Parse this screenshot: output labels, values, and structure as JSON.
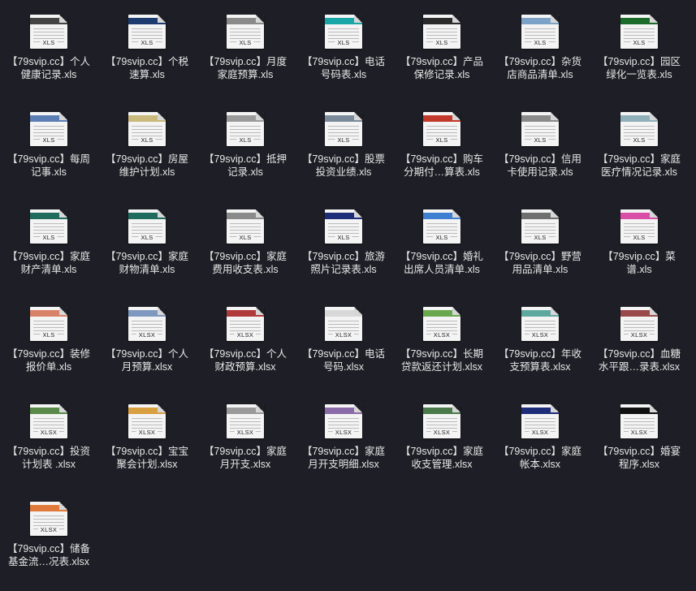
{
  "files": [
    {
      "name": "【79svip.cc】个人\n健康记录.xls",
      "ext": "XLS",
      "accent": "#444444",
      "icon": "spreadsheet-file-icon"
    },
    {
      "name": "【79svip.cc】个税\n速算.xls",
      "ext": "XLS",
      "accent": "#1d3b6e",
      "icon": "spreadsheet-file-icon"
    },
    {
      "name": "【79svip.cc】月度\n家庭预算.xls",
      "ext": "XLS",
      "accent": "#8a8a8a",
      "icon": "spreadsheet-file-icon"
    },
    {
      "name": "【79svip.cc】电话\n号码表.xls",
      "ext": "XLS",
      "accent": "#19a6a6",
      "icon": "spreadsheet-file-icon"
    },
    {
      "name": "【79svip.cc】产品\n保修记录.xls",
      "ext": "XLS",
      "accent": "#2b2b2b",
      "icon": "spreadsheet-file-icon"
    },
    {
      "name": "【79svip.cc】杂货\n店商品清单.xls",
      "ext": "XLS",
      "accent": "#7da2c7",
      "icon": "spreadsheet-file-icon"
    },
    {
      "name": "【79svip.cc】园区\n绿化一览表.xls",
      "ext": "XLS",
      "accent": "#1b6b2a",
      "icon": "spreadsheet-file-icon"
    },
    {
      "name": "【79svip.cc】每周\n记事.xls",
      "ext": "XLS",
      "accent": "#5b7fb5",
      "icon": "spreadsheet-file-icon"
    },
    {
      "name": "【79svip.cc】房屋\n维护计划.xls",
      "ext": "XLS",
      "accent": "#c9b97a",
      "icon": "spreadsheet-file-icon"
    },
    {
      "name": "【79svip.cc】抵押\n记录.xls",
      "ext": "XLS",
      "accent": "#9a9a9a",
      "icon": "spreadsheet-file-icon"
    },
    {
      "name": "【79svip.cc】股票\n投资业绩.xls",
      "ext": "XLS",
      "accent": "#7a8a9a",
      "icon": "spreadsheet-file-icon"
    },
    {
      "name": "【79svip.cc】购车\n分期付…算表.xls",
      "ext": "XLS",
      "accent": "#c0392b",
      "icon": "spreadsheet-file-icon"
    },
    {
      "name": "【79svip.cc】信用\n卡使用记录.xls",
      "ext": "XLS",
      "accent": "#8a8a8a",
      "icon": "spreadsheet-file-icon"
    },
    {
      "name": "【79svip.cc】家庭\n医疗情况记录.xls",
      "ext": "XLS",
      "accent": "#8fb0b8",
      "icon": "spreadsheet-file-icon"
    },
    {
      "name": "【79svip.cc】家庭\n财产清单.xls",
      "ext": "XLS",
      "accent": "#1f6b5e",
      "icon": "spreadsheet-file-icon"
    },
    {
      "name": "【79svip.cc】家庭\n财物清单.xls",
      "ext": "XLS",
      "accent": "#1f6b5e",
      "icon": "spreadsheet-file-icon"
    },
    {
      "name": "【79svip.cc】家庭\n费用收支表.xls",
      "ext": "XLS",
      "accent": "#8a8a8a",
      "icon": "spreadsheet-file-icon"
    },
    {
      "name": "【79svip.cc】旅游\n照片记录表.xls",
      "ext": "XLS",
      "accent": "#1e2d7a",
      "icon": "spreadsheet-file-icon"
    },
    {
      "name": "【79svip.cc】婚礼\n出席人员清单.xls",
      "ext": "XLS",
      "accent": "#3f7fd1",
      "icon": "spreadsheet-file-icon"
    },
    {
      "name": "【79svip.cc】野营\n用品清单.xls",
      "ext": "XLS",
      "accent": "#6f6f6f",
      "icon": "spreadsheet-file-icon"
    },
    {
      "name": "【79svip.cc】菜\n谱.xls",
      "ext": "XLS",
      "accent": "#d94fa8",
      "icon": "spreadsheet-file-icon"
    },
    {
      "name": "【79svip.cc】装修\n报价单.xls",
      "ext": "XLS",
      "accent": "#d9826a",
      "icon": "spreadsheet-file-icon"
    },
    {
      "name": "【79svip.cc】个人\n月预算.xlsx",
      "ext": "XLSX",
      "accent": "#7f98bf",
      "icon": "spreadsheet-file-icon"
    },
    {
      "name": "【79svip.cc】个人\n财政预算.xlsx",
      "ext": "XLSX",
      "accent": "#b03a3a",
      "icon": "spreadsheet-file-icon"
    },
    {
      "name": "【79svip.cc】电话\n号码.xlsx",
      "ext": "XLSX",
      "accent": "#d8d8d8",
      "icon": "spreadsheet-file-icon"
    },
    {
      "name": "【79svip.cc】长期\n贷款返还计划.xlsx",
      "ext": "XLSX",
      "accent": "#6aa84f",
      "icon": "spreadsheet-file-icon"
    },
    {
      "name": "【79svip.cc】年收\n支预算表.xlsx",
      "ext": "XLSX",
      "accent": "#5fa8a0",
      "icon": "spreadsheet-file-icon"
    },
    {
      "name": "【79svip.cc】血糖\n水平跟…录表.xlsx",
      "ext": "XLSX",
      "accent": "#9a4a4a",
      "icon": "spreadsheet-file-icon"
    },
    {
      "name": "【79svip.cc】投资\n计划表 .xlsx",
      "ext": "XLSX",
      "accent": "#5a8a4a",
      "icon": "spreadsheet-file-icon"
    },
    {
      "name": "【79svip.cc】宝宝\n聚会计划.xlsx",
      "ext": "XLSX",
      "accent": "#d8a040",
      "icon": "spreadsheet-file-icon"
    },
    {
      "name": "【79svip.cc】家庭\n月开支.xlsx",
      "ext": "XLSX",
      "accent": "#9a9a9a",
      "icon": "spreadsheet-file-icon"
    },
    {
      "name": "【79svip.cc】家庭\n月开支明细.xlsx",
      "ext": "XLSX",
      "accent": "#8a6aa8",
      "icon": "spreadsheet-file-icon"
    },
    {
      "name": "【79svip.cc】家庭\n收支管理.xlsx",
      "ext": "XLSX",
      "accent": "#4a7a4a",
      "icon": "spreadsheet-file-icon"
    },
    {
      "name": "【79svip.cc】家庭\n帐本.xlsx",
      "ext": "XLSX",
      "accent": "#1e2d7a",
      "icon": "spreadsheet-file-icon"
    },
    {
      "name": "【79svip.cc】婚宴\n程序.xlsx",
      "ext": "XLSX",
      "accent": "#111111",
      "icon": "spreadsheet-file-icon"
    },
    {
      "name": "【79svip.cc】储备\n基金流…况表.xlsx",
      "ext": "XLSX",
      "accent": "#e07a3a",
      "icon": "spreadsheet-file-icon"
    }
  ]
}
